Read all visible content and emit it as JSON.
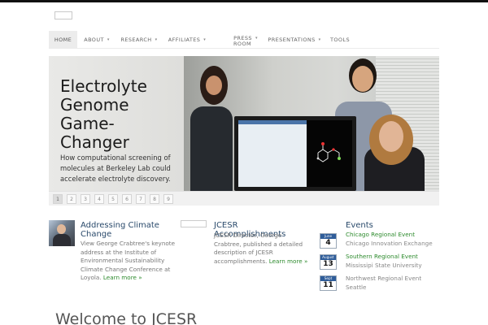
{
  "nav": {
    "items": [
      {
        "label": "HOME",
        "caret": false
      },
      {
        "label": "ABOUT",
        "caret": true
      },
      {
        "label": "RESEARCH",
        "caret": true
      },
      {
        "label": "AFFILIATES",
        "caret": true
      },
      {
        "label_line1": "PRESS",
        "label_line2": "ROOM",
        "caret": true
      },
      {
        "label": "PRESENTATIONS",
        "caret": true
      },
      {
        "label": "TOOLS",
        "caret": false
      }
    ],
    "caret_glyph": "▾"
  },
  "hero": {
    "title": "Electrolyte Genome Game-Changer",
    "subtitle": "How computational screening of molecules at Berkeley Lab could accelerate electrolyte discovery."
  },
  "pager": {
    "pages": [
      "1",
      "2",
      "3",
      "4",
      "5",
      "6",
      "7",
      "8",
      "9"
    ],
    "active": "1"
  },
  "columns": {
    "climate": {
      "title": "Addressing Climate Change",
      "text": "View George Crabtree's keynote address at the Institute of Environmental Sustainability Climate Change Conference at Loyola.",
      "more": "Learn more »"
    },
    "jcesr": {
      "title": "JCESR Accomplishments",
      "text": "JCESR Director, George Crabtree, published a detailed description of JCESR accomplishments.",
      "more": "Learn more »"
    },
    "events": {
      "title": "Events",
      "items": [
        {
          "month": "June",
          "day": "4",
          "title": "Chicago Regional Event",
          "location": "Chicago Innovation Exchange",
          "linked": true
        },
        {
          "month": "August",
          "day": "13",
          "title": "Southern Regional Event",
          "location": "Mississipi State University",
          "linked": true
        },
        {
          "month": "Sept",
          "day": "11",
          "title": "Northwest Regional Event",
          "location": "Seattle",
          "linked": false
        }
      ]
    }
  },
  "welcome": {
    "heading": "Welcome to JCESR"
  },
  "colors": {
    "link_green": "#2e8b2e",
    "heading_blue": "#2a4a6b",
    "calendar_blue": "#2f5d9a"
  }
}
